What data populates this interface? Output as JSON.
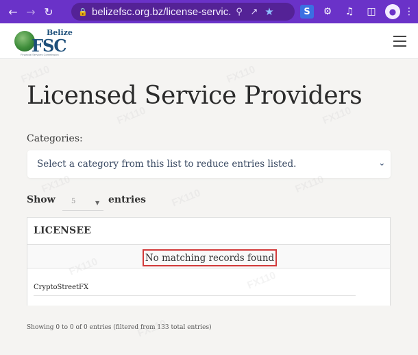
{
  "browser": {
    "url": "belizefsc.org.bz/license-servic...",
    "nav_icons": {
      "back": "arrow-left-icon",
      "forward": "arrow-right-icon",
      "reload": "reload-icon"
    },
    "omnibox_icons": [
      "lock-icon",
      "zoom-icon",
      "share-icon",
      "bookmark-star-icon"
    ],
    "extensions": [
      "s-extension-icon",
      "puzzle-extensions-icon",
      "media-queue-icon",
      "side-panel-icon",
      "profile-icon",
      "more-menu-icon"
    ],
    "extension_s_label": "S",
    "theme_color": "#6a32c8"
  },
  "site": {
    "logo": {
      "belize": "Belize",
      "fsc": "FSC",
      "tagline": "Financial Services Commission"
    },
    "menu_icon": "hamburger-menu-icon"
  },
  "main": {
    "title": "Licensed Service Providers",
    "categories_label": "Categories:",
    "category_select": {
      "value": "Select a category from this list to reduce entries listed.",
      "icon": "chevron-down-icon"
    },
    "show": {
      "show_label": "Show",
      "page_length": "5",
      "entries_label": "entries"
    },
    "table": {
      "column_header": "LICENSEE",
      "empty_message": "No matching records found",
      "search_value": "CryptoStreetFX"
    },
    "info": "Showing 0 to 0 of 0 entries (filtered from 133 total entries)"
  },
  "colors": {
    "highlight_border": "#d23a3a"
  }
}
